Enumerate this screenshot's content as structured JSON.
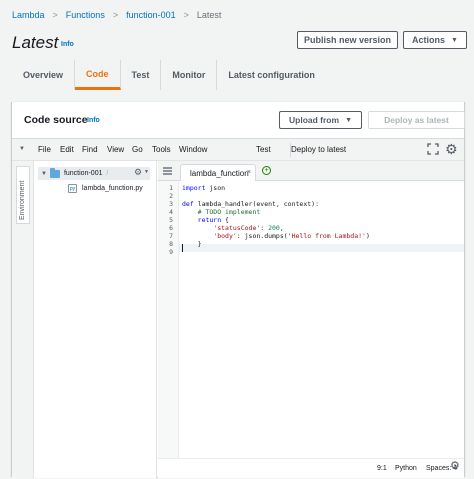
{
  "breadcrumb": {
    "items": [
      "Lambda",
      "Functions",
      "function-001"
    ],
    "current": "Latest",
    "separator": ">"
  },
  "header": {
    "title": "Latest",
    "info": "Info",
    "publish_label": "Publish new version",
    "actions_label": "Actions",
    "caret": "▼"
  },
  "tabs": [
    "Overview",
    "Code",
    "Test",
    "Monitor",
    "Latest configuration"
  ],
  "active_tab": "Code",
  "code_source": {
    "title": "Code source",
    "info": "Info",
    "upload_label": "Upload from",
    "deploy_label": "Deploy as latest"
  },
  "ide": {
    "menu": [
      "File",
      "Edit",
      "Find",
      "View",
      "Go",
      "Tools",
      "Window",
      "Test",
      "Deploy to latest"
    ],
    "sidebar_tab": "Environment",
    "tree": {
      "folder": "function-001",
      "folder_suffix": "/",
      "file": "lambda_function.py"
    },
    "editor_tab": "lambda_function",
    "tab_close": "×",
    "tab_add": "+",
    "line_numbers": [
      "1",
      "2",
      "3",
      "4",
      "5",
      "6",
      "7",
      "8",
      "9"
    ],
    "code_lines": [
      "import json",
      "",
      "def lambda_handler(event, context):",
      "    # TODO implement",
      "    return {",
      "        'statusCode': 200,",
      "        'body': json.dumps('Hello from Lambda!')",
      "    }",
      ""
    ],
    "status": {
      "position": "9:1",
      "language": "Python",
      "spaces": "Spaces: 4"
    }
  },
  "colors": {
    "accent_orange": "#ec7211",
    "link_blue": "#0073bb",
    "keyword_blue": "#0000ff",
    "comment_green": "#236e25",
    "string_red": "#a31515",
    "number_green": "#098658"
  },
  "icons": {
    "expand": "fullscreen-icon",
    "settings": "gear-icon",
    "folder": "folder-icon",
    "file": "python-file-icon"
  }
}
